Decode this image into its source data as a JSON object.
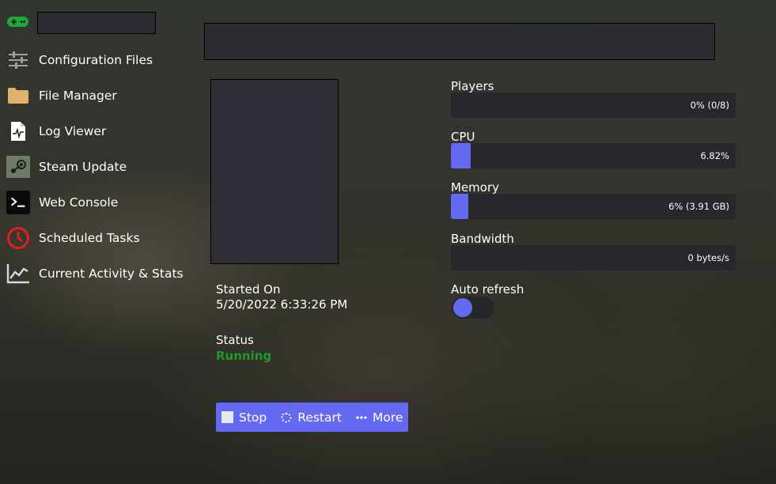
{
  "sidebar": {
    "brand_icon": "gamepad-icon",
    "items": [
      {
        "label": "Configuration Files",
        "icon": "sliders-icon"
      },
      {
        "label": "File Manager",
        "icon": "folder-icon"
      },
      {
        "label": "Log Viewer",
        "icon": "log-file-icon"
      },
      {
        "label": "Steam Update",
        "icon": "steam-icon"
      },
      {
        "label": "Web Console",
        "icon": "terminal-icon"
      },
      {
        "label": "Scheduled Tasks",
        "icon": "clock-icon"
      },
      {
        "label": "Current Activity & Stats",
        "icon": "chart-icon"
      }
    ]
  },
  "server": {
    "started_label": "Started On",
    "started_value": "5/20/2022 6:33:26 PM",
    "status_label": "Status",
    "status_value": "Running",
    "status_color": "#1f9a2a"
  },
  "actions": {
    "stop": "Stop",
    "restart": "Restart",
    "more": "More",
    "accent": "#6469f2"
  },
  "stats": {
    "players": {
      "label": "Players",
      "text": "0% (0/8)",
      "fraction": 0.0
    },
    "cpu": {
      "label": "CPU",
      "text": "6.82%",
      "fraction": 0.0682
    },
    "memory": {
      "label": "Memory",
      "text": "6% (3.91 GB)",
      "fraction": 0.06
    },
    "bandwidth": {
      "label": "Bandwidth",
      "text": "0 bytes/s",
      "fraction": 0.0
    }
  },
  "auto_refresh": {
    "label": "Auto refresh",
    "enabled": false
  }
}
